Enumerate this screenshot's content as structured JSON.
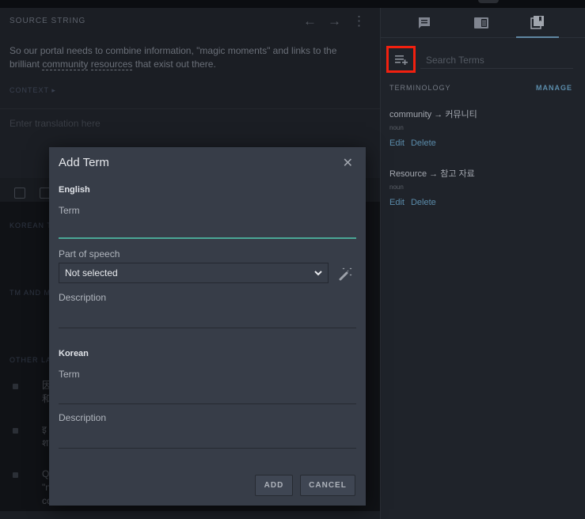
{
  "editor": {
    "source_heading": "SOURCE STRING",
    "source_text_before": "So our portal needs to combine information, \"magic moments\" and links to the brilliant ",
    "source_term_1": "community",
    "source_term_2": "resources",
    "source_text_after": " that exist out there.",
    "context_label": "CONTEXT ▸",
    "translation_placeholder": "Enter translation here",
    "sections": {
      "korean": "KOREAN T",
      "tm": "TM AND M",
      "other": "OTHER LA"
    },
    "other_languages": [
      {
        "line1": "因",
        "line2": "和"
      },
      {
        "line1": "इ",
        "line2": "श"
      },
      {
        "line1": "Q",
        "line2": "\"n",
        "line3": "co"
      }
    ]
  },
  "sidebar": {
    "tabs": [
      {
        "icon": "comment-icon",
        "active": false
      },
      {
        "icon": "resources-icon",
        "active": false
      },
      {
        "icon": "terminology-icon",
        "active": true
      }
    ],
    "search_placeholder": "Search Terms",
    "terminology_heading": "TERMINOLOGY",
    "manage_label": "MANAGE",
    "terms": [
      {
        "source": "community",
        "arrow": "→",
        "target": "커뮤니티",
        "part_of_speech": "noun",
        "edit": "Edit",
        "delete": "Delete"
      },
      {
        "source": "Resource",
        "arrow": "→",
        "target": "참고 자료",
        "part_of_speech": "noun",
        "edit": "Edit",
        "delete": "Delete"
      }
    ],
    "accent_color": "#5b8cab",
    "highlight_color": "#f2200f"
  },
  "modal": {
    "title": "Add Term",
    "english_heading": "English",
    "english_term_label": "Term",
    "english_term_value": "",
    "pos_label": "Part of speech",
    "pos_selected": "Not selected",
    "english_description_label": "Description",
    "english_description_value": "",
    "korean_heading": "Korean",
    "korean_term_label": "Term",
    "korean_term_value": "",
    "korean_description_label": "Description",
    "korean_description_value": "",
    "add_label": "ADD",
    "cancel_label": "CANCEL",
    "focus_color": "#4aa796"
  }
}
